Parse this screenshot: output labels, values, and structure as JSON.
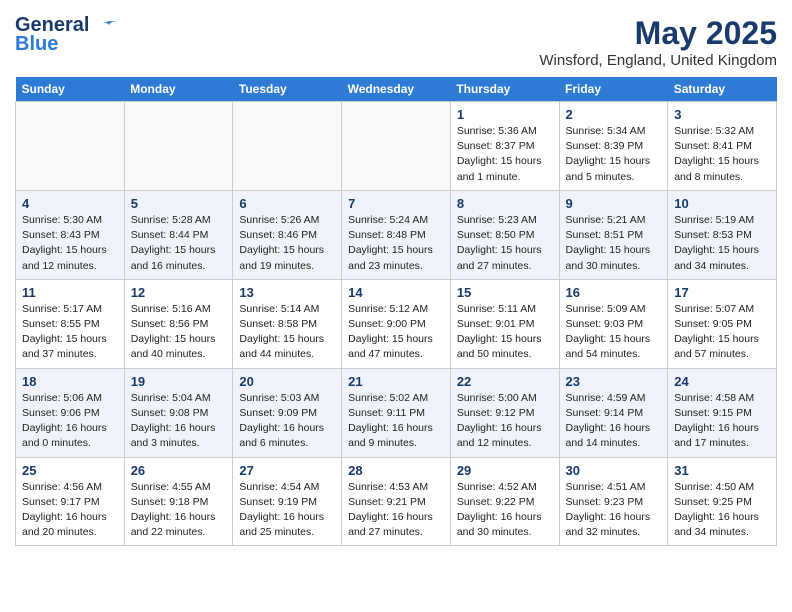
{
  "logo": {
    "line1": "General",
    "line2": "Blue"
  },
  "title": "May 2025",
  "subtitle": "Winsford, England, United Kingdom",
  "days_of_week": [
    "Sunday",
    "Monday",
    "Tuesday",
    "Wednesday",
    "Thursday",
    "Friday",
    "Saturday"
  ],
  "weeks": [
    [
      {
        "num": "",
        "info": ""
      },
      {
        "num": "",
        "info": ""
      },
      {
        "num": "",
        "info": ""
      },
      {
        "num": "",
        "info": ""
      },
      {
        "num": "1",
        "info": "Sunrise: 5:36 AM\nSunset: 8:37 PM\nDaylight: 15 hours and 1 minute."
      },
      {
        "num": "2",
        "info": "Sunrise: 5:34 AM\nSunset: 8:39 PM\nDaylight: 15 hours and 5 minutes."
      },
      {
        "num": "3",
        "info": "Sunrise: 5:32 AM\nSunset: 8:41 PM\nDaylight: 15 hours and 8 minutes."
      }
    ],
    [
      {
        "num": "4",
        "info": "Sunrise: 5:30 AM\nSunset: 8:43 PM\nDaylight: 15 hours and 12 minutes."
      },
      {
        "num": "5",
        "info": "Sunrise: 5:28 AM\nSunset: 8:44 PM\nDaylight: 15 hours and 16 minutes."
      },
      {
        "num": "6",
        "info": "Sunrise: 5:26 AM\nSunset: 8:46 PM\nDaylight: 15 hours and 19 minutes."
      },
      {
        "num": "7",
        "info": "Sunrise: 5:24 AM\nSunset: 8:48 PM\nDaylight: 15 hours and 23 minutes."
      },
      {
        "num": "8",
        "info": "Sunrise: 5:23 AM\nSunset: 8:50 PM\nDaylight: 15 hours and 27 minutes."
      },
      {
        "num": "9",
        "info": "Sunrise: 5:21 AM\nSunset: 8:51 PM\nDaylight: 15 hours and 30 minutes."
      },
      {
        "num": "10",
        "info": "Sunrise: 5:19 AM\nSunset: 8:53 PM\nDaylight: 15 hours and 34 minutes."
      }
    ],
    [
      {
        "num": "11",
        "info": "Sunrise: 5:17 AM\nSunset: 8:55 PM\nDaylight: 15 hours and 37 minutes."
      },
      {
        "num": "12",
        "info": "Sunrise: 5:16 AM\nSunset: 8:56 PM\nDaylight: 15 hours and 40 minutes."
      },
      {
        "num": "13",
        "info": "Sunrise: 5:14 AM\nSunset: 8:58 PM\nDaylight: 15 hours and 44 minutes."
      },
      {
        "num": "14",
        "info": "Sunrise: 5:12 AM\nSunset: 9:00 PM\nDaylight: 15 hours and 47 minutes."
      },
      {
        "num": "15",
        "info": "Sunrise: 5:11 AM\nSunset: 9:01 PM\nDaylight: 15 hours and 50 minutes."
      },
      {
        "num": "16",
        "info": "Sunrise: 5:09 AM\nSunset: 9:03 PM\nDaylight: 15 hours and 54 minutes."
      },
      {
        "num": "17",
        "info": "Sunrise: 5:07 AM\nSunset: 9:05 PM\nDaylight: 15 hours and 57 minutes."
      }
    ],
    [
      {
        "num": "18",
        "info": "Sunrise: 5:06 AM\nSunset: 9:06 PM\nDaylight: 16 hours and 0 minutes."
      },
      {
        "num": "19",
        "info": "Sunrise: 5:04 AM\nSunset: 9:08 PM\nDaylight: 16 hours and 3 minutes."
      },
      {
        "num": "20",
        "info": "Sunrise: 5:03 AM\nSunset: 9:09 PM\nDaylight: 16 hours and 6 minutes."
      },
      {
        "num": "21",
        "info": "Sunrise: 5:02 AM\nSunset: 9:11 PM\nDaylight: 16 hours and 9 minutes."
      },
      {
        "num": "22",
        "info": "Sunrise: 5:00 AM\nSunset: 9:12 PM\nDaylight: 16 hours and 12 minutes."
      },
      {
        "num": "23",
        "info": "Sunrise: 4:59 AM\nSunset: 9:14 PM\nDaylight: 16 hours and 14 minutes."
      },
      {
        "num": "24",
        "info": "Sunrise: 4:58 AM\nSunset: 9:15 PM\nDaylight: 16 hours and 17 minutes."
      }
    ],
    [
      {
        "num": "25",
        "info": "Sunrise: 4:56 AM\nSunset: 9:17 PM\nDaylight: 16 hours and 20 minutes."
      },
      {
        "num": "26",
        "info": "Sunrise: 4:55 AM\nSunset: 9:18 PM\nDaylight: 16 hours and 22 minutes."
      },
      {
        "num": "27",
        "info": "Sunrise: 4:54 AM\nSunset: 9:19 PM\nDaylight: 16 hours and 25 minutes."
      },
      {
        "num": "28",
        "info": "Sunrise: 4:53 AM\nSunset: 9:21 PM\nDaylight: 16 hours and 27 minutes."
      },
      {
        "num": "29",
        "info": "Sunrise: 4:52 AM\nSunset: 9:22 PM\nDaylight: 16 hours and 30 minutes."
      },
      {
        "num": "30",
        "info": "Sunrise: 4:51 AM\nSunset: 9:23 PM\nDaylight: 16 hours and 32 minutes."
      },
      {
        "num": "31",
        "info": "Sunrise: 4:50 AM\nSunset: 9:25 PM\nDaylight: 16 hours and 34 minutes."
      }
    ]
  ]
}
